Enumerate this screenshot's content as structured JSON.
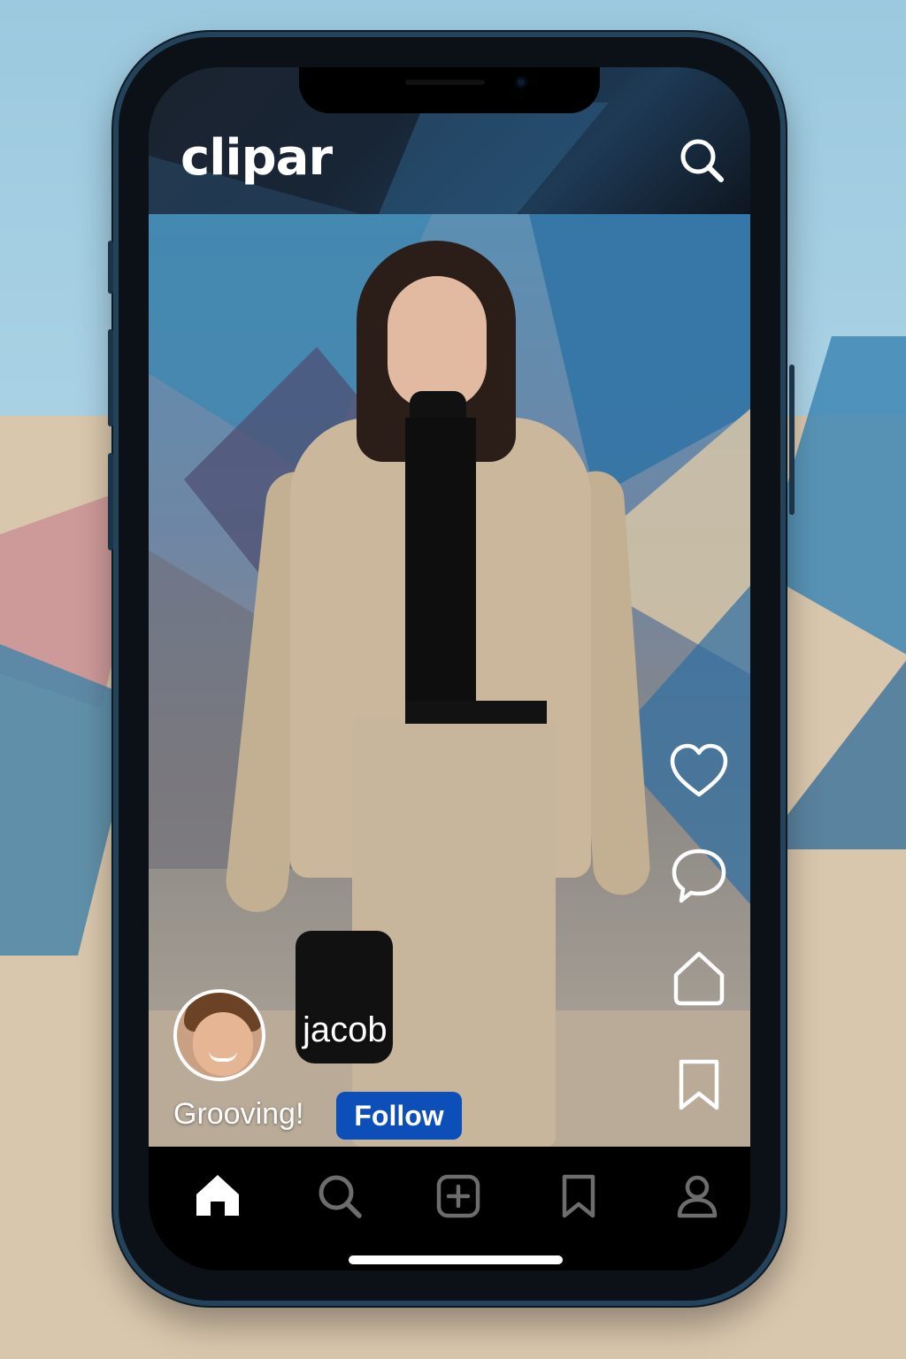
{
  "app": {
    "name": "clipar"
  },
  "header": {
    "logo": "clipar",
    "search_icon": "search-icon"
  },
  "post": {
    "username": "jacob",
    "caption": "Grooving!",
    "follow_label": "Follow"
  },
  "actions": [
    {
      "name": "like",
      "icon": "heart-icon"
    },
    {
      "name": "comment",
      "icon": "comment-icon"
    },
    {
      "name": "share",
      "icon": "share-icon"
    },
    {
      "name": "save",
      "icon": "bookmark-icon"
    }
  ],
  "bottom_nav": [
    {
      "name": "home",
      "icon": "home-icon",
      "active": true
    },
    {
      "name": "search",
      "icon": "search-icon",
      "active": false
    },
    {
      "name": "create",
      "icon": "add-icon",
      "active": false
    },
    {
      "name": "saved",
      "icon": "bookmark-icon",
      "active": false
    },
    {
      "name": "profile",
      "icon": "profile-icon",
      "active": false
    }
  ],
  "colors": {
    "follow_button": "#0d4fb8",
    "nav_active": "#ffffff",
    "nav_inactive": "#6d6d6d",
    "phone_frame": "#24425a"
  }
}
